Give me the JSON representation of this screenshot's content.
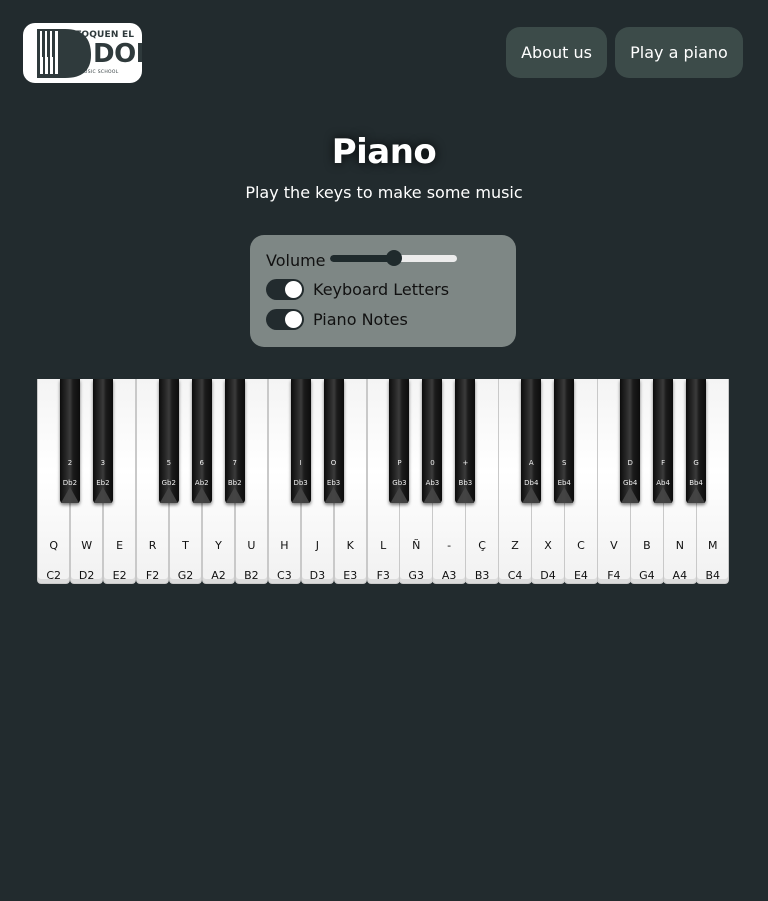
{
  "header": {
    "logo": {
      "top_text": "TOQUEN EL",
      "big_text": "DOM",
      "small_text": "MUSIC SCHOOL"
    },
    "nav": [
      {
        "label": "About us"
      },
      {
        "label": "Play a piano"
      }
    ]
  },
  "main": {
    "title": "Piano",
    "subtitle": "Play the keys to make some music"
  },
  "controls": {
    "volume_label": "Volume",
    "volume_level": 0.5,
    "keyboard_letters_label": "Keyboard Letters",
    "keyboard_letters_on": true,
    "piano_notes_label": "Piano Notes",
    "piano_notes_on": true
  },
  "piano": {
    "white_keys": [
      {
        "letter": "Q",
        "note": "C2"
      },
      {
        "letter": "W",
        "note": "D2"
      },
      {
        "letter": "E",
        "note": "E2"
      },
      {
        "letter": "R",
        "note": "F2"
      },
      {
        "letter": "T",
        "note": "G2"
      },
      {
        "letter": "Y",
        "note": "A2"
      },
      {
        "letter": "U",
        "note": "B2"
      },
      {
        "letter": "H",
        "note": "C3"
      },
      {
        "letter": "J",
        "note": "D3"
      },
      {
        "letter": "K",
        "note": "E3"
      },
      {
        "letter": "L",
        "note": "F3"
      },
      {
        "letter": "Ñ",
        "note": "G3"
      },
      {
        "letter": "-",
        "note": "A3"
      },
      {
        "letter": "Ç",
        "note": "B3"
      },
      {
        "letter": "Z",
        "note": "C4"
      },
      {
        "letter": "X",
        "note": "D4"
      },
      {
        "letter": "C",
        "note": "E4"
      },
      {
        "letter": "V",
        "note": "F4"
      },
      {
        "letter": "B",
        "note": "G4"
      },
      {
        "letter": "N",
        "note": "A4"
      },
      {
        "letter": "M",
        "note": "B4"
      }
    ],
    "black_keys": [
      {
        "letter": "2",
        "note": "Db2"
      },
      {
        "letter": "3",
        "note": "Eb2"
      },
      {
        "letter": "5",
        "note": "Gb2"
      },
      {
        "letter": "6",
        "note": "Ab2"
      },
      {
        "letter": "7",
        "note": "Bb2"
      },
      {
        "letter": "I",
        "note": "Db3"
      },
      {
        "letter": "O",
        "note": "Eb3"
      },
      {
        "letter": "P",
        "note": "Gb3"
      },
      {
        "letter": "0",
        "note": "Ab3"
      },
      {
        "letter": "+",
        "note": "Bb3"
      },
      {
        "letter": "A",
        "note": "Db4"
      },
      {
        "letter": "S",
        "note": "Eb4"
      },
      {
        "letter": "D",
        "note": "Gb4"
      },
      {
        "letter": "F",
        "note": "Ab4"
      },
      {
        "letter": "G",
        "note": "Bb4"
      }
    ]
  }
}
